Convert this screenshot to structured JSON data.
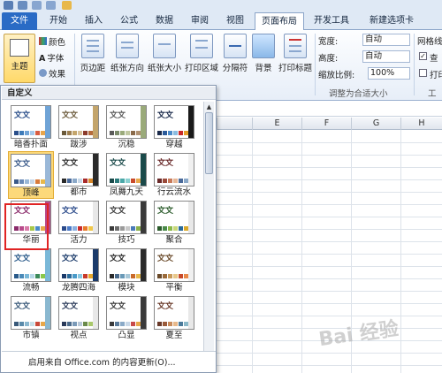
{
  "ribbon_tabs": [
    "文件",
    "开始",
    "插入",
    "公式",
    "数据",
    "审阅",
    "视图",
    "页面布局",
    "开发工具",
    "新建选项卡"
  ],
  "themes_group": {
    "theme_button": "主题",
    "colors": "颜色",
    "fonts": "字体",
    "effects": "效果"
  },
  "page_setup": {
    "margins": "页边距",
    "orientation": "纸张方向",
    "size": "纸张大小",
    "print_area": "打印区域",
    "breaks": "分隔符",
    "background": "背景",
    "print_titles": "打印标题"
  },
  "scale_to_fit": {
    "width_label": "宽度:",
    "width_value": "自动",
    "height_label": "高度:",
    "height_value": "自动",
    "scale_label": "缩放比例:",
    "scale_value": "100%",
    "group_label": "调整为合适大小"
  },
  "sheet_options": {
    "gridlines": "网格线",
    "view": "查",
    "print": "打印",
    "group_label": "工作"
  },
  "column_headers": [
    "E",
    "F",
    "G",
    "H",
    "I"
  ],
  "panel": {
    "header": "自定义",
    "themes": [
      {
        "name": "暗香扑面",
        "label": "文文",
        "colors": [
          "#2b4f8a",
          "#3d7ab8",
          "#6fa3d6",
          "#a6c9eb",
          "#d85c41",
          "#e8a54b"
        ],
        "strip": "#6fa3d6"
      },
      {
        "name": "跋涉",
        "label": "文文",
        "colors": [
          "#6b5a3a",
          "#9c7e4f",
          "#c4a56b",
          "#d8c29a",
          "#8b3a2a",
          "#b56b3c"
        ],
        "strip": "#c4a56b"
      },
      {
        "name": "沉稳",
        "label": "文文",
        "colors": [
          "#5a5a5a",
          "#7a8a6a",
          "#9aaa7a",
          "#c0c8a0",
          "#8a6a4a",
          "#b09070"
        ],
        "strip": "#9aaa7a"
      },
      {
        "name": "穿越",
        "label": "文文",
        "colors": [
          "#1a2a4a",
          "#2a5a9a",
          "#4a8ac8",
          "#8abce0",
          "#c82a2a",
          "#e8a02a"
        ],
        "strip": "#1a1a1a"
      },
      {
        "name": "顶峰",
        "label": "文文",
        "colors": [
          "#3a5a8a",
          "#6a8ab8",
          "#9ab8d8",
          "#c8d8e8",
          "#d87a3a",
          "#e8b84a"
        ],
        "strip": "#9ab8d8"
      },
      {
        "name": "都市",
        "label": "文文",
        "colors": [
          "#2a2a2a",
          "#4a6a9a",
          "#8aa8c8",
          "#c8d8e8",
          "#a82a2a",
          "#d8882a"
        ],
        "strip": "#2a2a2a"
      },
      {
        "name": "凤舞九天",
        "label": "文文",
        "colors": [
          "#1a4a4a",
          "#2a7a7a",
          "#4aa8a8",
          "#8ad0d0",
          "#c84a2a",
          "#e8a84a"
        ],
        "strip": "#1a4a4a"
      },
      {
        "name": "行云流水",
        "label": "文文",
        "colors": [
          "#6a2a2a",
          "#9a4a3a",
          "#c87a5a",
          "#e8b898",
          "#4a6a9a",
          "#8aa8c8"
        ],
        "strip": "#f0f0f0"
      },
      {
        "name": "华丽",
        "label": "文文",
        "colors": [
          "#8a2a6a",
          "#b84a8a",
          "#d87aa8",
          "#a8c84a",
          "#4a8ac8",
          "#e8a84a"
        ],
        "strip": "#b84a8a"
      },
      {
        "name": "活力",
        "label": "文文",
        "colors": [
          "#2a4a8a",
          "#4a7ac8",
          "#8ab0e0",
          "#c82a2a",
          "#e87a2a",
          "#f0c84a"
        ],
        "strip": "#e8e8e8"
      },
      {
        "name": "技巧",
        "label": "文文",
        "colors": [
          "#3a3a3a",
          "#6a6a6a",
          "#9a9a9a",
          "#c8c8c8",
          "#4a7ab8",
          "#8ab04a"
        ],
        "strip": "#3a3a3a"
      },
      {
        "name": "聚合",
        "label": "文文",
        "colors": [
          "#2a5a2a",
          "#4a8a4a",
          "#8ab84a",
          "#c8d87a",
          "#2a6a9a",
          "#d8a82a"
        ],
        "strip": "#e8e8e8"
      },
      {
        "name": "流畅",
        "label": "文文",
        "colors": [
          "#2a5a8a",
          "#4a8ab8",
          "#7ab8d8",
          "#b8d8e8",
          "#3a8a5a",
          "#8ac84a"
        ],
        "strip": "#7ab8d8"
      },
      {
        "name": "龙腾四海",
        "label": "文文",
        "colors": [
          "#1a3a6a",
          "#2a6a9a",
          "#4a9ac8",
          "#8ac8e0",
          "#c83a2a",
          "#e8a82a"
        ],
        "strip": "#1a3a6a"
      },
      {
        "name": "模块",
        "label": "文文",
        "colors": [
          "#2a2a2a",
          "#4a6a8a",
          "#6a9ab8",
          "#a8c8d8",
          "#c86a2a",
          "#e8b84a"
        ],
        "strip": "#2a2a2a"
      },
      {
        "name": "平衡",
        "label": "文文",
        "colors": [
          "#6a4a2a",
          "#9a6a3a",
          "#c89a5a",
          "#e8c88a",
          "#c84a2a",
          "#e88a4a"
        ],
        "strip": "#f0f0f0"
      },
      {
        "name": "市镇",
        "label": "文文",
        "colors": [
          "#3a5a7a",
          "#5a8aaa",
          "#8ab8d0",
          "#c8e0e8",
          "#c84a3a",
          "#e8a84a"
        ],
        "strip": "#8ab8d0"
      },
      {
        "name": "视点",
        "label": "文文",
        "colors": [
          "#2a3a5a",
          "#4a6a8a",
          "#7a9ab8",
          "#b8c8d8",
          "#6a8a4a",
          "#a8c86a"
        ],
        "strip": "#e8e8e8"
      },
      {
        "name": "凸显",
        "label": "文文",
        "colors": [
          "#3a3a3a",
          "#5a7a9a",
          "#8aaac8",
          "#c8d8e8",
          "#c84a4a",
          "#e8a84a"
        ],
        "strip": "#3a3a3a"
      },
      {
        "name": "夏至",
        "label": "文文",
        "colors": [
          "#6a3a2a",
          "#9a5a3a",
          "#c88a5a",
          "#e8b88a",
          "#4a7a9a",
          "#8ab8c8"
        ],
        "strip": "#e8e8e8"
      }
    ],
    "footer_item": "启用来自 Office.com 的内容更新(O)..."
  },
  "watermark": "Bai 经验"
}
